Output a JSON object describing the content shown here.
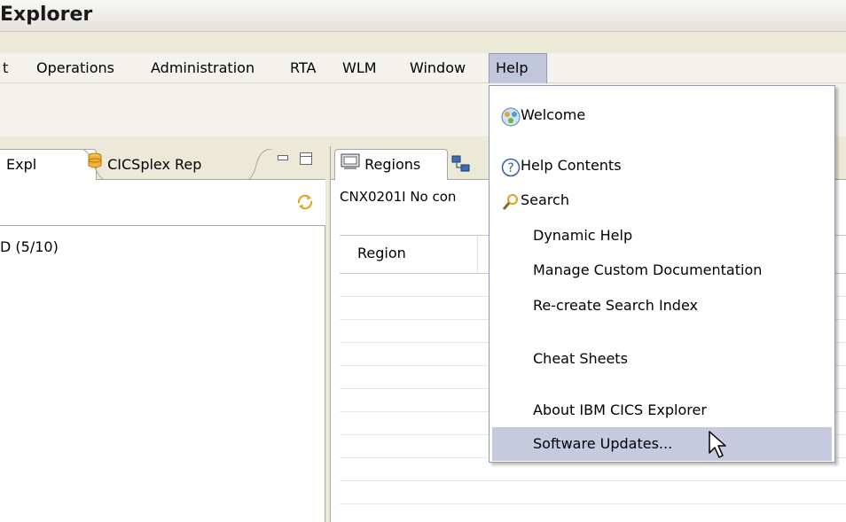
{
  "window": {
    "title": "Explorer"
  },
  "menubar": {
    "items": [
      "t",
      "Operations",
      "Administration",
      "RTA",
      "WLM",
      "Window",
      "Help"
    ],
    "active": "Help"
  },
  "left_view": {
    "tabs": [
      {
        "label": "Expl"
      },
      {
        "label": "CICSplex Rep"
      }
    ],
    "tree_item": "D (5/10)"
  },
  "right_view": {
    "tabs": [
      {
        "label": "Regions"
      }
    ],
    "status": "CNX0201I No con",
    "column_header": "Region"
  },
  "help_menu": {
    "welcome": "Welcome",
    "help_contents": "Help Contents",
    "search": "Search",
    "dynamic_help": "Dynamic Help",
    "manage_docs": "Manage Custom Documentation",
    "recreate_index": "Re-create Search Index",
    "cheat_sheets": "Cheat Sheets",
    "about": "About IBM CICS Explorer",
    "software_updates": "Software Updates..."
  },
  "colors": {
    "menu_highlight": "#c6cadf",
    "menu_border": "#8f98b5",
    "chrome": "#ece9d8"
  }
}
